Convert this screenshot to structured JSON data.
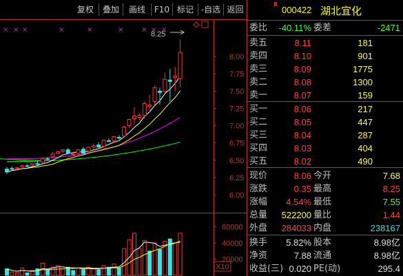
{
  "toolbar": {
    "buttons": [
      {
        "label": "复权"
      },
      {
        "label": "叠加"
      },
      {
        "label": "画线"
      },
      {
        "label": "F10"
      },
      {
        "label": "标记"
      },
      {
        "label": "-自选"
      },
      {
        "label": "返回"
      }
    ]
  },
  "stock": {
    "flag": "R",
    "code": "000422",
    "name": "湖北宜化"
  },
  "summary": {
    "weibi_label": "委比",
    "weibi_value": "-40.11%",
    "weicha_label": "委差",
    "weicha_value": "-2471"
  },
  "order_book": {
    "sell": [
      {
        "label": "卖五",
        "price": "8.11",
        "volume": "181"
      },
      {
        "label": "卖四",
        "price": "8.10",
        "volume": "901"
      },
      {
        "label": "卖三",
        "price": "8.09",
        "volume": "1775"
      },
      {
        "label": "卖二",
        "price": "8.08",
        "volume": "1300"
      },
      {
        "label": "卖一",
        "price": "8.07",
        "volume": "159"
      }
    ],
    "buy": [
      {
        "label": "买一",
        "price": "8.06",
        "volume": "217"
      },
      {
        "label": "买二",
        "price": "8.05",
        "volume": "447"
      },
      {
        "label": "买三",
        "price": "8.04",
        "volume": "287"
      },
      {
        "label": "买四",
        "price": "8.03",
        "volume": "404"
      },
      {
        "label": "买五",
        "price": "8.02",
        "volume": "490"
      }
    ]
  },
  "quote": {
    "rows": [
      {
        "l1": "现价",
        "v1": "8.06",
        "l2": "今开",
        "v2": "7.68"
      },
      {
        "l1": "涨跌",
        "v1": "0.35",
        "l2": "最高",
        "v2": "8.25"
      },
      {
        "l1": "涨幅",
        "v1": "4.54%",
        "l2": "最低",
        "v2": "7.55"
      },
      {
        "l1": "总量",
        "v1": "522200",
        "l2": "量比",
        "v2": "1.44"
      },
      {
        "l1": "外盘",
        "v1": "284033",
        "l2": "内盘",
        "v2": "238167"
      }
    ]
  },
  "fundamentals": {
    "rows": [
      {
        "l1": "换手",
        "v1": "5.82%",
        "l2": "股本",
        "v2": "8.98亿"
      },
      {
        "l1": "净资",
        "v1": "7.88",
        "l2": "流通",
        "v2": "8.98亿"
      },
      {
        "l1": "收益(三)",
        "v1": "0.020",
        "l2": "PE(动)",
        "v2": "295.4"
      }
    ]
  },
  "chart": {
    "peak_label": "8.25",
    "price_ticks": [
      "8.00",
      "7.75",
      "7.50",
      "7.25",
      "7.00",
      "6.75",
      "6.50",
      "6.25",
      "6.00"
    ],
    "volume_ticks": [
      "60000",
      "40000",
      "20000"
    ],
    "volume_unit": "X10",
    "marker": "×",
    "colors": {
      "up": "#ff3030",
      "down": "#40e0e0",
      "ma5": "#ffffff",
      "ma10": "#ffff00",
      "ma20": "#ff00ff",
      "ma60": "#00ff00",
      "axis": "#c83030"
    }
  },
  "chart_data": {
    "type": "candlestick",
    "ylim": [
      5.93,
      8.32
    ],
    "candles": [
      {
        "o": 6.37,
        "h": 6.4,
        "l": 6.3,
        "c": 6.33
      },
      {
        "o": 6.38,
        "h": 6.41,
        "l": 6.35,
        "c": 6.37
      },
      {
        "o": 6.38,
        "h": 6.4,
        "l": 6.36,
        "c": 6.39
      },
      {
        "o": 6.4,
        "h": 6.43,
        "l": 6.39,
        "c": 6.42
      },
      {
        "o": 6.42,
        "h": 6.44,
        "l": 6.4,
        "c": 6.41
      },
      {
        "o": 6.43,
        "h": 6.46,
        "l": 6.41,
        "c": 6.45
      },
      {
        "o": 6.45,
        "h": 6.49,
        "l": 6.42,
        "c": 6.44
      },
      {
        "o": 6.47,
        "h": 6.53,
        "l": 6.45,
        "c": 6.52
      },
      {
        "o": 6.52,
        "h": 6.55,
        "l": 6.5,
        "c": 6.51
      },
      {
        "o": 6.55,
        "h": 6.62,
        "l": 6.53,
        "c": 6.59
      },
      {
        "o": 6.6,
        "h": 6.64,
        "l": 6.58,
        "c": 6.62
      },
      {
        "o": 6.63,
        "h": 6.66,
        "l": 6.61,
        "c": 6.65
      },
      {
        "o": 6.65,
        "h": 6.68,
        "l": 6.59,
        "c": 6.6
      },
      {
        "o": 6.58,
        "h": 6.62,
        "l": 6.54,
        "c": 6.59
      },
      {
        "o": 6.6,
        "h": 6.66,
        "l": 6.59,
        "c": 6.65
      },
      {
        "o": 6.66,
        "h": 6.69,
        "l": 6.59,
        "c": 6.6
      },
      {
        "o": 6.63,
        "h": 6.7,
        "l": 6.62,
        "c": 6.69
      },
      {
        "o": 6.69,
        "h": 6.74,
        "l": 6.66,
        "c": 6.71
      },
      {
        "o": 6.72,
        "h": 6.76,
        "l": 6.68,
        "c": 6.69
      },
      {
        "o": 6.7,
        "h": 6.8,
        "l": 6.69,
        "c": 6.79
      },
      {
        "o": 6.78,
        "h": 6.82,
        "l": 6.76,
        "c": 6.77
      },
      {
        "o": 6.78,
        "h": 6.85,
        "l": 6.75,
        "c": 6.84
      },
      {
        "o": 6.83,
        "h": 6.86,
        "l": 6.8,
        "c": 6.82
      },
      {
        "o": 6.85,
        "h": 7.0,
        "l": 6.84,
        "c": 6.98
      },
      {
        "o": 7.0,
        "h": 7.1,
        "l": 6.97,
        "c": 7.09
      },
      {
        "o": 7.1,
        "h": 7.27,
        "l": 7.03,
        "c": 7.14
      },
      {
        "o": 7.12,
        "h": 7.18,
        "l": 7.07,
        "c": 7.15
      },
      {
        "o": 7.15,
        "h": 7.35,
        "l": 7.1,
        "c": 7.32
      },
      {
        "o": 7.28,
        "h": 7.45,
        "l": 7.2,
        "c": 7.3
      },
      {
        "o": 7.35,
        "h": 7.58,
        "l": 7.3,
        "c": 7.55
      },
      {
        "o": 7.5,
        "h": 7.55,
        "l": 7.3,
        "c": 7.48
      },
      {
        "o": 7.5,
        "h": 7.77,
        "l": 7.45,
        "c": 7.67
      },
      {
        "o": 7.66,
        "h": 7.82,
        "l": 7.35,
        "c": 7.64
      },
      {
        "o": 7.7,
        "h": 7.85,
        "l": 7.5,
        "c": 7.72
      },
      {
        "o": 7.68,
        "h": 8.25,
        "l": 7.55,
        "c": 8.06
      }
    ],
    "volumes": [
      {
        "v": 8000,
        "up": false
      },
      {
        "v": 4000,
        "up": true
      },
      {
        "v": 3000,
        "up": true
      },
      {
        "v": 9000,
        "up": true
      },
      {
        "v": 3000,
        "up": false
      },
      {
        "v": 6000,
        "up": true
      },
      {
        "v": 8000,
        "up": false
      },
      {
        "v": 15000,
        "up": true
      },
      {
        "v": 7000,
        "up": false
      },
      {
        "v": 10000,
        "up": true
      },
      {
        "v": 12000,
        "up": true
      },
      {
        "v": 8000,
        "up": true
      },
      {
        "v": 10000,
        "up": false
      },
      {
        "v": 6000,
        "up": false
      },
      {
        "v": 9000,
        "up": true
      },
      {
        "v": 7000,
        "up": false
      },
      {
        "v": 10000,
        "up": true
      },
      {
        "v": 8000,
        "up": true
      },
      {
        "v": 7000,
        "up": false
      },
      {
        "v": 12000,
        "up": true
      },
      {
        "v": 10000,
        "up": false
      },
      {
        "v": 14000,
        "up": true
      },
      {
        "v": 9000,
        "up": false
      },
      {
        "v": 33000,
        "up": true
      },
      {
        "v": 44000,
        "up": true
      },
      {
        "v": 52000,
        "up": true
      },
      {
        "v": 33000,
        "up": true
      },
      {
        "v": 43000,
        "up": true
      },
      {
        "v": 30000,
        "up": false
      },
      {
        "v": 40000,
        "up": true
      },
      {
        "v": 32000,
        "up": false
      },
      {
        "v": 42000,
        "up": true
      },
      {
        "v": 45000,
        "up": false
      },
      {
        "v": 40000,
        "up": true
      },
      {
        "v": 52000,
        "up": true
      }
    ],
    "volume_ylim": [
      0,
      68000
    ]
  }
}
